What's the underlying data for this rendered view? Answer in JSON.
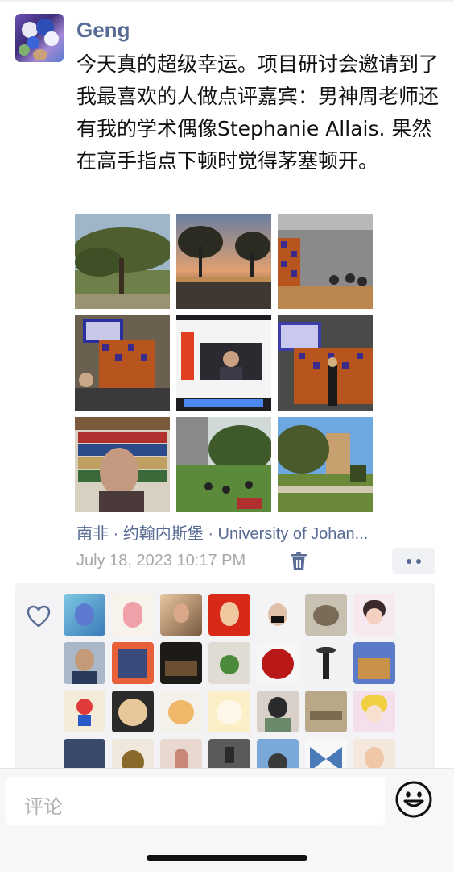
{
  "post": {
    "username": "Geng",
    "text": "今天真的超级幸运。项目研讨会邀请到了我最喜欢的人做点评嘉宾：男神周老师还有我的学术偶像Stephanie Allais. 果然在高手指点下顿时觉得茅塞顿开。",
    "location": "南非 · 约翰内斯堡 · University of Johan...",
    "timestamp": "July 18, 2023 10:17 PM",
    "photo_count": 9,
    "liker_count": 28
  },
  "icons": {
    "delete": "trash-icon",
    "more": "more-dots-icon",
    "like": "heart-icon",
    "emoji": "smiley-icon"
  },
  "comment": {
    "placeholder": "评论"
  },
  "colors": {
    "link": "#576b95",
    "timestamp": "#a8a8a8",
    "likes_bg": "#f3f3f5"
  }
}
